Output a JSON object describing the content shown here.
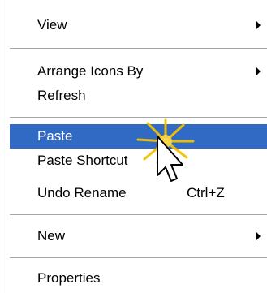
{
  "menu": {
    "items": [
      {
        "label": "View",
        "has_submenu": true
      },
      {
        "label": "Arrange Icons By",
        "has_submenu": true
      },
      {
        "label": "Refresh"
      },
      {
        "label": "Paste",
        "selected": true
      },
      {
        "label": "Paste Shortcut"
      },
      {
        "label": "Undo Rename",
        "shortcut": "Ctrl+Z"
      },
      {
        "label": "New",
        "has_submenu": true
      },
      {
        "label": "Properties"
      }
    ]
  },
  "colors": {
    "highlight": "#316ac5",
    "highlight_text": "#ffffff",
    "separator": "#a5a5a5",
    "sparkle": "#f2c200"
  },
  "cursor": {
    "icon": "arrow-pointer-icon",
    "effect": "click-sparkle-icon"
  }
}
